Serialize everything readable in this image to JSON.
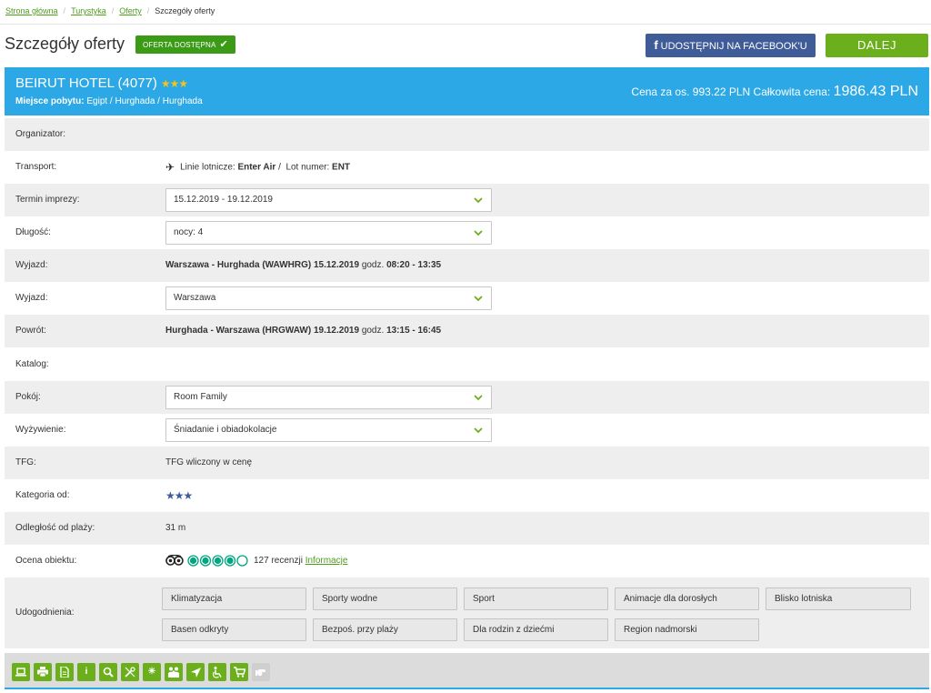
{
  "breadcrumb": {
    "home": "Strona główna",
    "tourism": "Turystyka",
    "offers": "Oferty",
    "current": "Szczegóły oferty"
  },
  "header": {
    "title": "Szczegóły oferty",
    "badge": "OFERTA DOSTĘPNA",
    "badge_icon": "check-icon",
    "facebook_label": "UDOSTĘPNIJ NA FACEBOOK'U",
    "next_label": "DALEJ"
  },
  "offer": {
    "hotel_name": "BEIRUT HOTEL",
    "hotel_code": "(4077)",
    "hotel_stars": "★★★",
    "location_label": "Miejsce pobytu:",
    "location_value": "Egipt / Hurghada / Hurghada",
    "price_per_person_label": "Cena za os.",
    "price_per_person": "993.22 PLN",
    "total_label": "Całkowita cena:",
    "total_price": "1986.43 PLN"
  },
  "details": {
    "organizer_label": "Organizator:",
    "transport_label": "Transport:",
    "transport_airline_label": "Linie lotnicze:",
    "transport_airline": "Enter Air",
    "transport_sep": "/",
    "transport_flight_label": "Lot numer:",
    "transport_flight": "ENT",
    "term_label": "Termin imprezy:",
    "term_value": "15.12.2019 - 19.12.2019",
    "length_label": "Długość:",
    "length_value": "nocy: 4",
    "departure_label": "Wyjazd:",
    "departure_route": "Warszawa - Hurghada (WAWHRG) 15.12.2019",
    "departure_time_label": "godz.",
    "departure_time": "08:20 - 13:35",
    "departure_city_label": "Wyjazd:",
    "departure_city": "Warszawa",
    "return_label": "Powrót:",
    "return_route": "Hurghada - Warszawa (HRGWAW) 19.12.2019",
    "return_time_label": "godz.",
    "return_time": "13:15 - 16:45",
    "catalog_label": "Katalog:",
    "room_label": "Pokój:",
    "room_value": "Room Family",
    "board_label": "Wyżywienie:",
    "board_value": "Śniadanie i obiadokolacje",
    "tfg_label": "TFG:",
    "tfg_value": "TFG wliczony w cenę",
    "category_label": "Kategoria od:",
    "category_stars": "★★★",
    "beach_label": "Odległość od plaży:",
    "beach_value": "31 m",
    "rating_label": "Ocena obiektu:",
    "rating_bubbles": 4,
    "reviews": "127 recenzji",
    "rating_link": "Informacje",
    "amenities_label": "Udogodnienia:"
  },
  "amenities": [
    "Klimatyzacja",
    "Sporty wodne",
    "Sport",
    "Animacje dla dorosłych",
    "Blisko lotniska",
    "Basen odkryty",
    "Bezpoś. przy plaży",
    "Dla rodzin z dziećmi",
    "Region nadmorski"
  ],
  "toolbar_icons": [
    "laptop-icon",
    "print-icon",
    "document-icon",
    "info-icon",
    "search-icon",
    "tools-icon",
    "sun-icon",
    "family-icon",
    "location-arrow-icon",
    "wheelchair-icon",
    "shopping-cart-icon",
    "hand-icon"
  ],
  "colors": {
    "accent_blue": "#2ba8e5",
    "green": "#6caf1c",
    "facebook": "#3f5c98",
    "row_grey": "#eeeeee"
  }
}
